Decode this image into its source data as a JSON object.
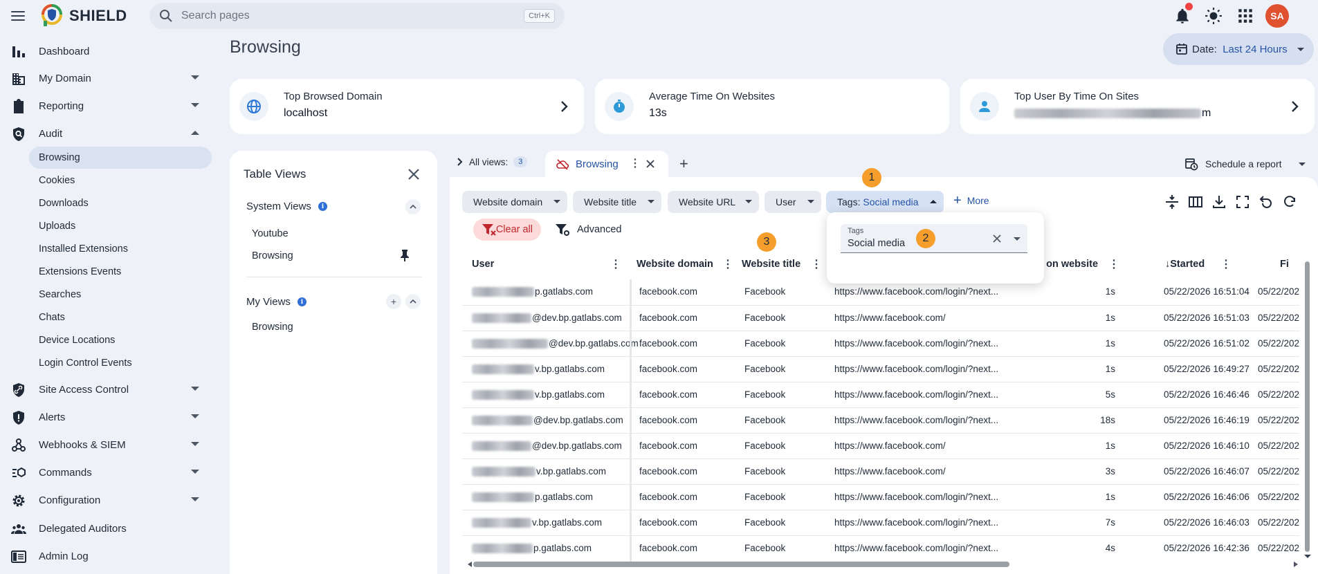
{
  "app": {
    "brand": "SHIELD"
  },
  "search": {
    "placeholder": "Search pages",
    "shortcut": "Ctrl+K"
  },
  "user": {
    "initials": "SA"
  },
  "sidebar": {
    "items": [
      {
        "label": "Dashboard",
        "icon": "bar-chart-icon"
      },
      {
        "label": "My Domain",
        "icon": "domain-icon"
      },
      {
        "label": "Reporting",
        "icon": "clipboard-icon"
      },
      {
        "label": "Audit",
        "icon": "audit-shield-icon"
      },
      {
        "label": "Site Access Control",
        "icon": "link-shield-icon"
      },
      {
        "label": "Alerts",
        "icon": "alert-shield-icon"
      },
      {
        "label": "Webhooks & SIEM",
        "icon": "webhook-icon"
      },
      {
        "label": "Commands",
        "icon": "commands-icon"
      },
      {
        "label": "Configuration",
        "icon": "gear-icon"
      },
      {
        "label": "Delegated Auditors",
        "icon": "group-icon"
      },
      {
        "label": "Admin Log",
        "icon": "log-icon"
      }
    ],
    "audit_sub": [
      "Browsing",
      "Cookies",
      "Downloads",
      "Uploads",
      "Installed Extensions",
      "Extensions Events",
      "Searches",
      "Chats",
      "Device Locations",
      "Login Control Events"
    ]
  },
  "page": {
    "title": "Browsing"
  },
  "date_filter": {
    "label": "Date:",
    "value": "Last 24 Hours"
  },
  "cards": [
    {
      "title": "Top Browsed Domain",
      "value": "localhost",
      "icon": "globe-icon"
    },
    {
      "title": "Average Time On Websites",
      "value": "13s",
      "icon": "stopwatch-icon"
    },
    {
      "title": "Top User By Time On Sites",
      "value_suffix": "m",
      "icon": "person-icon"
    }
  ],
  "table_views": {
    "title": "Table Views",
    "system_title": "System Views",
    "system_items": [
      "Youtube",
      "Browsing"
    ],
    "my_title": "My Views",
    "my_items": [
      "Browsing"
    ]
  },
  "tabs": {
    "all_views_label": "All views:",
    "all_views_count": "3",
    "active_tab": "Browsing",
    "schedule": "Schedule a report"
  },
  "filters": {
    "chips": [
      "Website domain",
      "Website title",
      "Website URL",
      "User"
    ],
    "tags_label": "Tags:",
    "tags_value": "Social media",
    "more": "More",
    "clear_all": "Clear all",
    "advanced": "Advanced"
  },
  "popover": {
    "field_label": "Tags",
    "field_value": "Social media"
  },
  "markers": [
    "1",
    "2",
    "3"
  ],
  "table": {
    "columns": {
      "user": "User",
      "domain": "Website domain",
      "title": "Website title",
      "time": "e on website",
      "started": "Started",
      "finished": "Fi"
    },
    "rows": [
      {
        "user": "p.gatlabs.com",
        "domain": "facebook.com",
        "title": "Facebook",
        "url": "https://www.facebook.com/login/?next...",
        "time": "1s",
        "started": "05/22/2026 16:51:04",
        "finished": "05/22/202"
      },
      {
        "user": "@dev.bp.gatlabs.com",
        "domain": "facebook.com",
        "title": "Facebook",
        "url": "https://www.facebook.com/",
        "time": "1s",
        "started": "05/22/2026 16:51:03",
        "finished": "05/22/202"
      },
      {
        "user": "@dev.bp.gatlabs.com",
        "domain": "facebook.com",
        "title": "Facebook",
        "url": "https://www.facebook.com/login/?next...",
        "time": "1s",
        "started": "05/22/2026 16:51:02",
        "finished": "05/22/202"
      },
      {
        "user": "v.bp.gatlabs.com",
        "domain": "facebook.com",
        "title": "Facebook",
        "url": "https://www.facebook.com/login/?next...",
        "time": "1s",
        "started": "05/22/2026 16:49:27",
        "finished": "05/22/202("
      },
      {
        "user": "v.bp.gatlabs.com",
        "domain": "facebook.com",
        "title": "Facebook",
        "url": "https://www.facebook.com/login/?next...",
        "time": "5s",
        "started": "05/22/2026 16:46:46",
        "finished": "05/22/202"
      },
      {
        "user": "@dev.bp.gatlabs.com",
        "domain": "facebook.com",
        "title": "Facebook",
        "url": "https://www.facebook.com/login/?next...",
        "time": "18s",
        "started": "05/22/2026 16:46:19",
        "finished": "05/22/202("
      },
      {
        "user": "@dev.bp.gatlabs.com",
        "domain": "facebook.com",
        "title": "Facebook",
        "url": "https://www.facebook.com/",
        "time": "1s",
        "started": "05/22/2026 16:46:10",
        "finished": "05/22/202"
      },
      {
        "user": "v.bp.gatlabs.com",
        "domain": "facebook.com",
        "title": "Facebook",
        "url": "https://www.facebook.com/",
        "time": "3s",
        "started": "05/22/2026 16:46:07",
        "finished": "05/22/202"
      },
      {
        "user": "p.gatlabs.com",
        "domain": "facebook.com",
        "title": "Facebook",
        "url": "https://www.facebook.com/login/?next...",
        "time": "1s",
        "started": "05/22/2026 16:46:06",
        "finished": "05/22/202("
      },
      {
        "user": "v.bp.gatlabs.com",
        "domain": "facebook.com",
        "title": "Facebook",
        "url": "https://www.facebook.com/login/?next...",
        "time": "7s",
        "started": "05/22/2026 16:46:03",
        "finished": "05/22/202("
      },
      {
        "user": "p.gatlabs.com",
        "domain": "facebook.com",
        "title": "Facebook",
        "url": "https://www.facebook.com/login/?next...",
        "time": "4s",
        "started": "05/22/2026 16:42:36",
        "finished": "05/22/202("
      }
    ]
  },
  "colors": {
    "accent": "#2453a5",
    "danger": "#c0262d",
    "marker": "#f59e2b",
    "avatar": "#e0522f"
  }
}
